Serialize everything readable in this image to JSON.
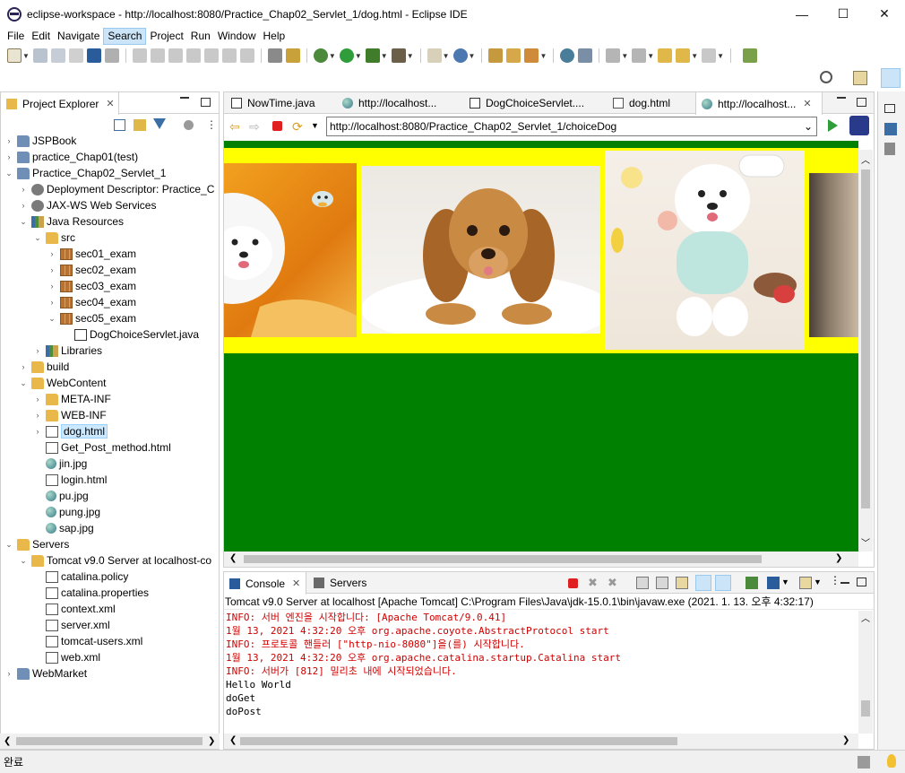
{
  "window": {
    "title": "eclipse-workspace - http://localhost:8080/Practice_Chap02_Servlet_1/dog.html - Eclipse IDE",
    "minimize": "—",
    "maximize": "☐",
    "close": "✕"
  },
  "menu": [
    "File",
    "Edit",
    "Navigate",
    "Search",
    "Project",
    "Run",
    "Window",
    "Help"
  ],
  "project_explorer": {
    "title": "Project Explorer",
    "close": "✕",
    "tree": [
      {
        "label": "JSPBook",
        "icon": "project-icon",
        "expanded": false
      },
      {
        "label": "practice_Chap01(test)",
        "icon": "project-icon",
        "expanded": false
      },
      {
        "label": "Practice_Chap02_Servlet_1",
        "icon": "project-icon",
        "expanded": true
      },
      {
        "label": "Deployment Descriptor: Practice_C",
        "icon": "deployment-descriptor-icon",
        "expanded": false
      },
      {
        "label": "JAX-WS Web Services",
        "icon": "jaxws-icon",
        "expanded": false
      },
      {
        "label": "Java Resources",
        "icon": "java-resources-icon",
        "expanded": true
      },
      {
        "label": "src",
        "icon": "source-folder-icon",
        "expanded": true
      },
      {
        "label": "sec01_exam",
        "icon": "package-icon",
        "expanded": false
      },
      {
        "label": "sec02_exam",
        "icon": "package-icon",
        "expanded": false
      },
      {
        "label": "sec03_exam",
        "icon": "package-icon",
        "expanded": false
      },
      {
        "label": "sec04_exam",
        "icon": "package-icon",
        "expanded": false
      },
      {
        "label": "sec05_exam",
        "icon": "package-icon",
        "expanded": true
      },
      {
        "label": "DogChoiceServlet.java",
        "icon": "java-file-icon",
        "expanded": false
      },
      {
        "label": "Libraries",
        "icon": "libraries-icon",
        "expanded": false
      },
      {
        "label": "build",
        "icon": "folder-icon",
        "expanded": false
      },
      {
        "label": "WebContent",
        "icon": "folder-icon",
        "expanded": true
      },
      {
        "label": "META-INF",
        "icon": "folder-icon",
        "expanded": false
      },
      {
        "label": "WEB-INF",
        "icon": "folder-icon",
        "expanded": false
      },
      {
        "label": "dog.html",
        "icon": "html-file-icon",
        "expanded": false,
        "selected": true
      },
      {
        "label": "Get_Post_method.html",
        "icon": "html-file-icon"
      },
      {
        "label": "jin.jpg",
        "icon": "image-file-icon"
      },
      {
        "label": "login.html",
        "icon": "html-file-icon"
      },
      {
        "label": "pu.jpg",
        "icon": "image-file-icon"
      },
      {
        "label": "pung.jpg",
        "icon": "image-file-icon"
      },
      {
        "label": "sap.jpg",
        "icon": "image-file-icon"
      },
      {
        "label": "Servers",
        "icon": "folder-icon",
        "expanded": true
      },
      {
        "label": "Tomcat v9.0 Server at localhost-co",
        "icon": "folder-icon",
        "expanded": true
      },
      {
        "label": "catalina.policy",
        "icon": "file-icon"
      },
      {
        "label": "catalina.properties",
        "icon": "file-icon"
      },
      {
        "label": "context.xml",
        "icon": "xml-file-icon"
      },
      {
        "label": "server.xml",
        "icon": "xml-file-icon"
      },
      {
        "label": "tomcat-users.xml",
        "icon": "xml-file-icon"
      },
      {
        "label": "web.xml",
        "icon": "xml-file-icon"
      },
      {
        "label": "WebMarket",
        "icon": "project-icon",
        "expanded": false
      }
    ]
  },
  "editor_tabs": [
    {
      "label": "NowTime.java",
      "icon": "java-file-icon"
    },
    {
      "label": "http://localhost...",
      "icon": "globe-icon"
    },
    {
      "label": "DogChoiceServlet....",
      "icon": "java-file-icon"
    },
    {
      "label": "dog.html",
      "icon": "html-file-icon"
    },
    {
      "label": "http://localhost...",
      "icon": "globe-icon",
      "active": true,
      "close": "✕"
    }
  ],
  "browser": {
    "url": "http://localhost:8080/Practice_Chap02_Servlet_1/choiceDog",
    "dropdown": "⌄"
  },
  "console": {
    "tabs": [
      {
        "label": "Console",
        "close": "✕",
        "active": true
      },
      {
        "label": "Servers"
      }
    ],
    "header": "Tomcat v9.0 Server at localhost [Apache Tomcat] C:\\Program Files\\Java\\jdk-15.0.1\\bin\\javaw.exe  (2021. 1. 13. 오후 4:32:17)",
    "lines": [
      {
        "text": "INFO: 서버 엔진을 시작합니다: [Apache Tomcat/9.0.41]",
        "color": "red"
      },
      {
        "text": "1월 13, 2021 4:32:20 오후 org.apache.coyote.AbstractProtocol start",
        "color": "red"
      },
      {
        "text": "INFO: 프로토콜 핸들러 [\"http-nio-8080\"]을(를) 시작합니다.",
        "color": "red"
      },
      {
        "text": "1월 13, 2021 4:32:20 오후 org.apache.catalina.startup.Catalina start",
        "color": "red"
      },
      {
        "text": "INFO: 서버가 [812] 밀리초 내에 시작되었습니다.",
        "color": "red"
      },
      {
        "text": "Hello World",
        "color": "black"
      },
      {
        "text": "doGet",
        "color": "black"
      },
      {
        "text": "doPost",
        "color": "black"
      }
    ]
  },
  "status": {
    "text": "완료"
  },
  "colors": {
    "page_bg": "#008000",
    "strip_bg": "#ffff00",
    "console_red": "#d00000",
    "selection": "#cce8ff"
  }
}
